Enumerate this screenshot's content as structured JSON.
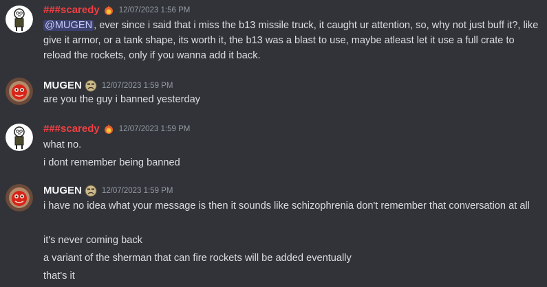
{
  "messages": [
    {
      "author": "###scaredy",
      "author_color": "#f23f42",
      "avatar": "doodle-avatar-icon",
      "badge": "fire-icon",
      "timestamp": "12/07/2023 1:56 PM",
      "mention": "@MUGEN",
      "lines": [
        ", ever since i said that i miss the b13 missile truck, it caught ur attention, so, why not just buff it?, like give it armor, or a tank shape, its worth it, the b13 was a blast to use, maybe atleast let it use a full crate to reload the rockets, only if you wanna add it back."
      ]
    },
    {
      "author": "MUGEN",
      "author_color": "#f2f3f5",
      "avatar": "red-ornament-avatar-icon",
      "badge": "sad-face-icon",
      "timestamp": "12/07/2023 1:59 PM",
      "lines": [
        "are you the guy i banned yesterday"
      ]
    },
    {
      "author": "###scaredy",
      "author_color": "#f23f42",
      "avatar": "doodle-avatar-icon",
      "badge": "fire-icon",
      "timestamp": "12/07/2023 1:59 PM",
      "lines": [
        "what no.",
        "i dont remember being banned"
      ]
    },
    {
      "author": "MUGEN",
      "author_color": "#f2f3f5",
      "avatar": "red-ornament-avatar-icon",
      "badge": "sad-face-icon",
      "timestamp": "12/07/2023 1:59 PM",
      "lines": [
        "i have no idea what your message is then it sounds like schizophrenia don't remember that conversation at all",
        "it's never coming back",
        "a variant of the sherman that can fire rockets will be added eventually",
        "that's it"
      ]
    }
  ]
}
